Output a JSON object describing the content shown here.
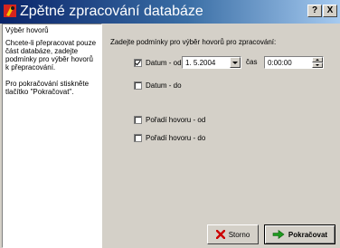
{
  "window": {
    "title": "Zpětné zpracování databáze",
    "help_button": "?",
    "close_button": "X"
  },
  "sidebar": {
    "heading": "Výběr hovorů",
    "paragraph1": "Chcete-li přepracovat pouze část databáze, zadejte podmínky pro výběr hovorů k přepracování.",
    "paragraph2": "Pro pokračování stiskněte tlačítko \"Pokračovat\"."
  },
  "main": {
    "prompt": "Zadejte podmínky pro výběr hovorů pro zpracování:",
    "date_from": {
      "label": "Datum - od",
      "checked": true,
      "value": "1. 5.2004"
    },
    "time_label": "čas",
    "time_value": "0:00:00",
    "date_to": {
      "label": "Datum - do",
      "checked": false
    },
    "order_from": {
      "label": "Pořadí hovoru - od",
      "checked": false
    },
    "order_to": {
      "label": "Pořadí hovoru - do",
      "checked": false
    }
  },
  "buttons": {
    "storno": "Storno",
    "continue": "Pokračovat"
  },
  "icons": {
    "app": "app-icon",
    "storno": "red-x-icon",
    "continue": "green-arrow-icon"
  },
  "colors": {
    "title_gradient_start": "#0a246a",
    "title_gradient_end": "#a6caf0",
    "storno_icon": "#cc0000",
    "continue_icon": "#1f9a1f"
  }
}
